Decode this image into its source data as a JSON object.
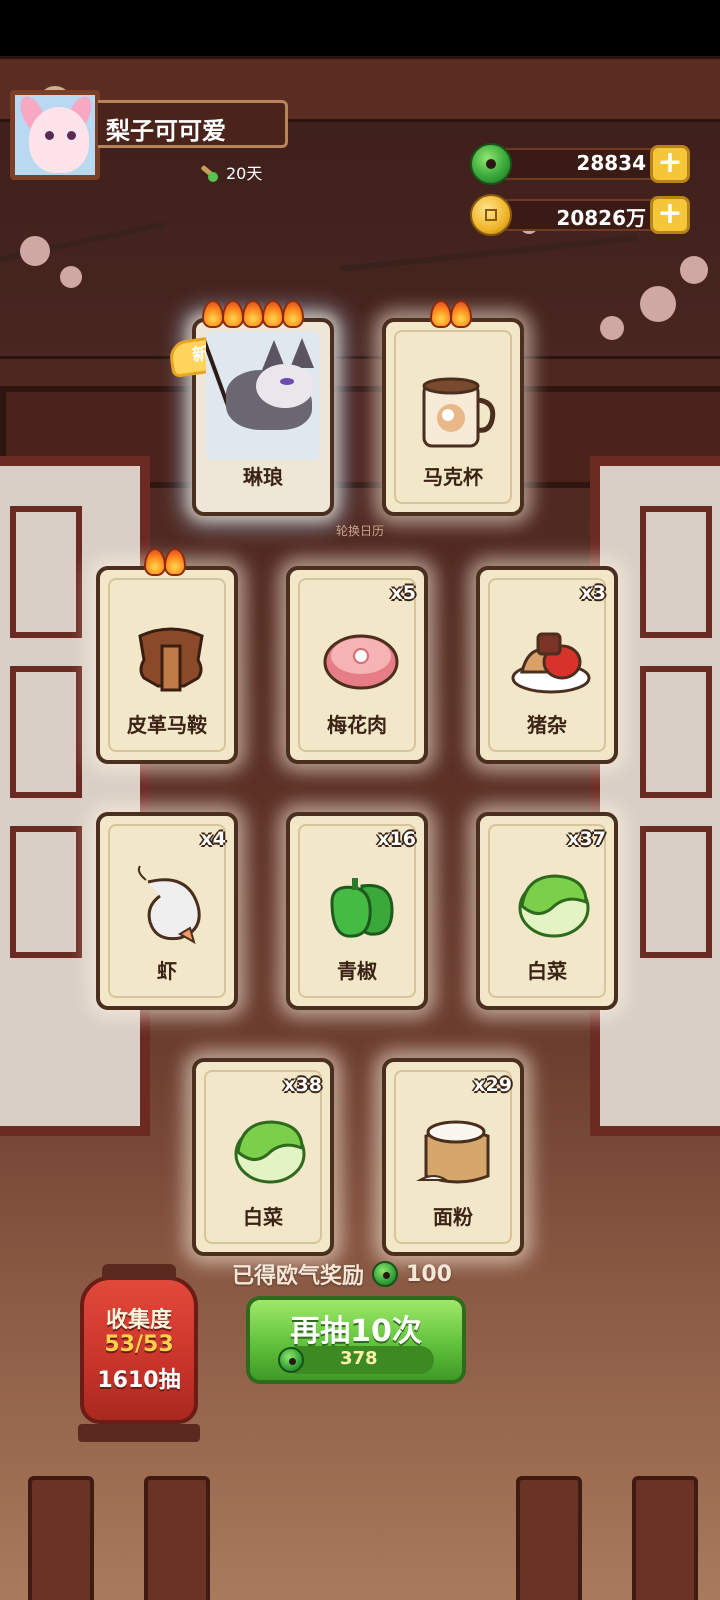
{
  "player": {
    "name": "梨子可可爱",
    "days": "20天"
  },
  "currency": {
    "jade": "28834",
    "coins": "20826万"
  },
  "watermark": "轮换日历",
  "cards": [
    {
      "name": "琳琅",
      "qty": "",
      "flames": 5,
      "is_new": true,
      "new_label": "新",
      "icon": "wolf-character-icon"
    },
    {
      "name": "马克杯",
      "qty": "",
      "flames": 2,
      "is_new": false,
      "icon": "mug-icon"
    },
    {
      "name": "皮革马鞍",
      "qty": "",
      "flames": 2,
      "is_new": false,
      "icon": "saddle-icon"
    },
    {
      "name": "梅花肉",
      "qty": "x5",
      "flames": 0,
      "is_new": false,
      "icon": "pork-icon"
    },
    {
      "name": "猪杂",
      "qty": "x3",
      "flames": 0,
      "is_new": false,
      "icon": "offal-icon"
    },
    {
      "name": "虾",
      "qty": "x4",
      "flames": 0,
      "is_new": false,
      "icon": "shrimp-icon"
    },
    {
      "name": "青椒",
      "qty": "x16",
      "flames": 0,
      "is_new": false,
      "icon": "pepper-icon"
    },
    {
      "name": "白菜",
      "qty": "x37",
      "flames": 0,
      "is_new": false,
      "icon": "cabbage-icon"
    },
    {
      "name": "白菜",
      "qty": "x38",
      "flames": 0,
      "is_new": false,
      "icon": "cabbage-icon"
    },
    {
      "name": "面粉",
      "qty": "x29",
      "flames": 0,
      "is_new": false,
      "icon": "flour-icon"
    }
  ],
  "reward": {
    "label": "已得欧气奖励",
    "amount": "100"
  },
  "draw_button": {
    "label": "再抽10次",
    "cost": "378"
  },
  "collection": {
    "title": "收集度",
    "progress": "53/53",
    "draws": "1610抽"
  },
  "colors": {
    "accent_green": "#61c23c",
    "lantern_red": "#c9342a",
    "card_bg": "#f3e7c9"
  }
}
